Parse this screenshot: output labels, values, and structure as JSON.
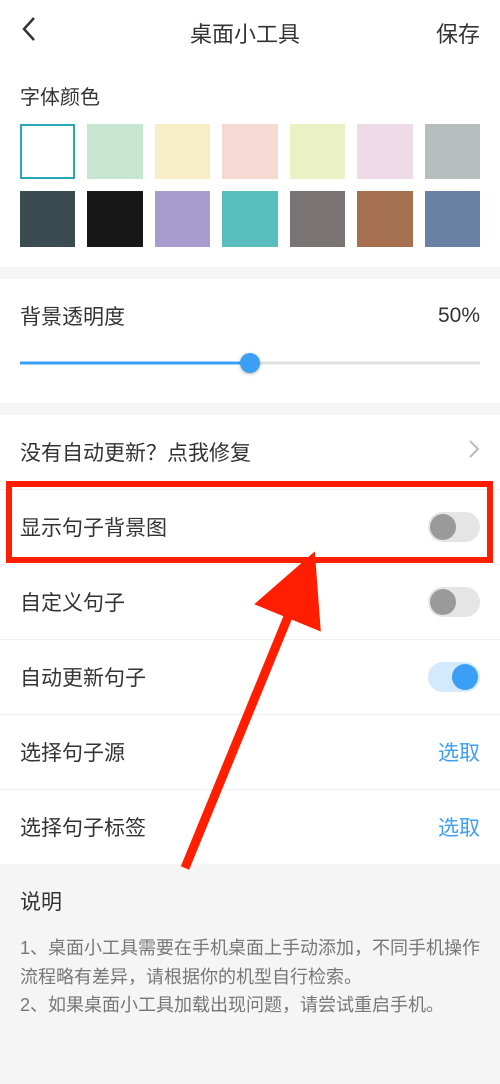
{
  "header": {
    "title": "桌面小工具",
    "save": "保存"
  },
  "fontColor": {
    "label": "字体颜色",
    "swatches": [
      {
        "color": "#ffffff",
        "selected": true
      },
      {
        "color": "#c6e6d2",
        "selected": false
      },
      {
        "color": "#f7edc7",
        "selected": false
      },
      {
        "color": "#f6d9d2",
        "selected": false
      },
      {
        "color": "#eaf2c5",
        "selected": false
      },
      {
        "color": "#efdae8",
        "selected": false
      },
      {
        "color": "#b7bebe",
        "selected": false
      },
      {
        "color": "#3a4c52",
        "selected": false
      },
      {
        "color": "#171717",
        "selected": false
      },
      {
        "color": "#a79cce",
        "selected": false
      },
      {
        "color": "#59bcbd",
        "selected": false
      },
      {
        "color": "#7a7373",
        "selected": false
      },
      {
        "color": "#a5704f",
        "selected": false
      },
      {
        "color": "#6981a2",
        "selected": false
      }
    ]
  },
  "opacity": {
    "label": "背景透明度",
    "value": "50%"
  },
  "rows": {
    "repair": "没有自动更新？点我修复",
    "showBg": "显示句子背景图",
    "custom": "自定义句子",
    "autoUpdate": "自动更新句子",
    "chooseSource": "选择句子源",
    "chooseTag": "选择句子标签",
    "select": "选取"
  },
  "toggles": {
    "showBg": false,
    "custom": false,
    "autoUpdate": true
  },
  "desc": {
    "title": "说明",
    "line1": "1、桌面小工具需要在手机桌面上手动添加，不同手机操作流程略有差异，请根据你的机型自行检索。",
    "line2": "2、如果桌面小工具加载出现问题，请尝试重启手机。"
  }
}
